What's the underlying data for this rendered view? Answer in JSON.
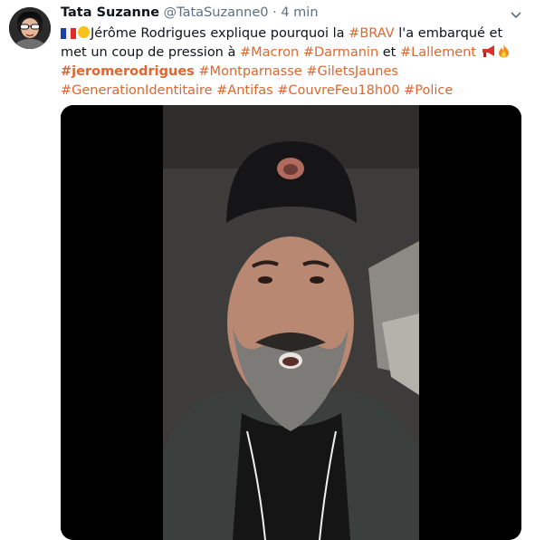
{
  "user": {
    "name": "Tata Suzanne",
    "handle": "@TataSuzanne0",
    "separator": "·",
    "time": "4 min"
  },
  "tweet": {
    "text1": "Jérôme Rodrigues explique pourquoi la ",
    "tag_brav": "#BRAV",
    "text2": " l'a embarqué et met un coup de pression à ",
    "tag_macron": "#Macron",
    "tag_darmanin": "#Darmanin",
    "text3": " et ",
    "tag_lallement": "#Lallement",
    "tag_jerome": "#jeromerodrigues",
    "tag_montparnasse": "#Montparnasse",
    "tag_gilets": "#GiletsJaunes",
    "tag_generation": "#GenerationIdentitaire",
    "tag_antifas": "#Antifas",
    "tag_couvrefeu": "#CouvreFeu18h00",
    "tag_police": "#Police"
  },
  "icons": {
    "flag": "france-flag-icon",
    "circle": "yellow-circle-icon",
    "megaphone": "megaphone-icon",
    "fire": "fire-icon",
    "caret": "chevron-down-icon"
  },
  "colors": {
    "hashtag": "#e0662d",
    "secondary_text": "#5b7083",
    "primary_text": "#0f1419"
  }
}
